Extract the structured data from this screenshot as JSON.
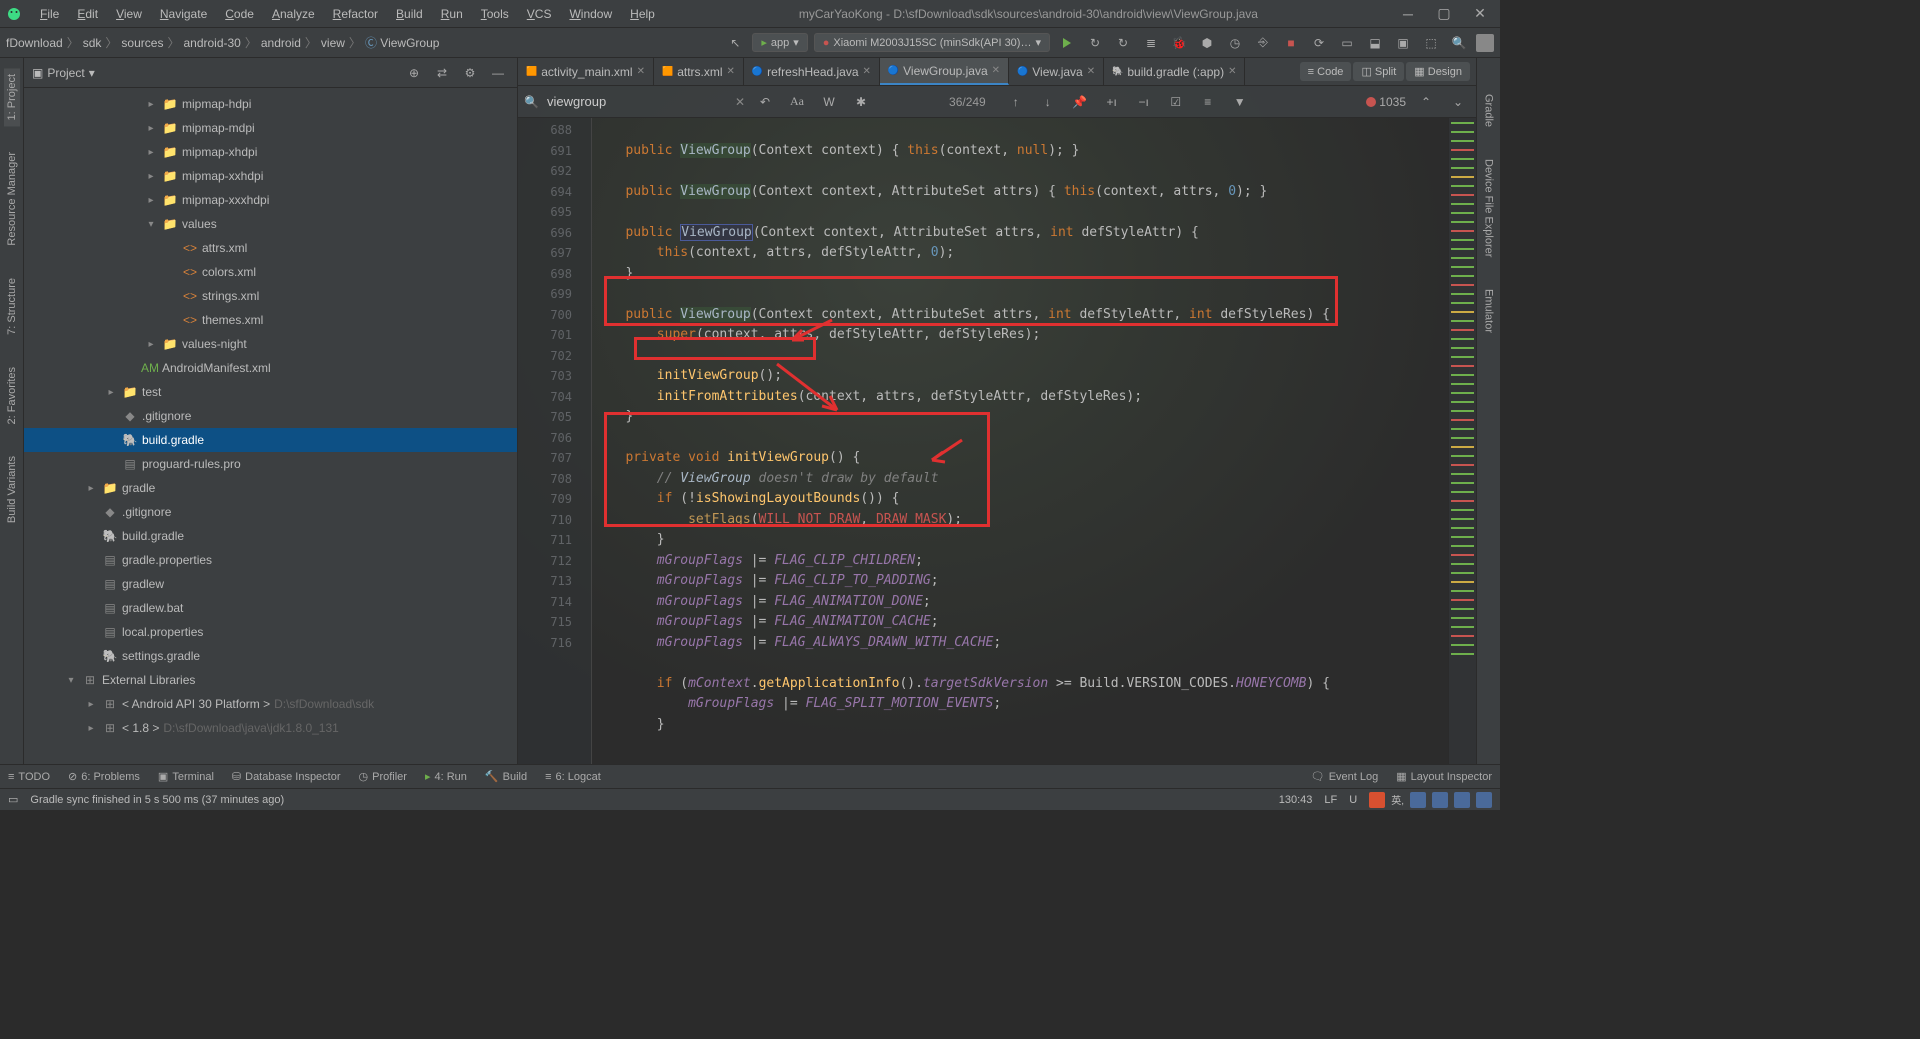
{
  "titlebar": {
    "title": "myCarYaoKong - D:\\sfDownload\\sdk\\sources\\android-30\\android\\view\\ViewGroup.java"
  },
  "menu": [
    "File",
    "Edit",
    "View",
    "Navigate",
    "Code",
    "Analyze",
    "Refactor",
    "Build",
    "Run",
    "Tools",
    "VCS",
    "Window",
    "Help"
  ],
  "breadcrumbs": [
    "fDownload",
    "sdk",
    "sources",
    "android-30",
    "android",
    "view",
    "ViewGroup"
  ],
  "run_config": {
    "app": "app",
    "device": "Xiaomi M2003J15SC (minSdk(API 30)…"
  },
  "project": {
    "title": "Project",
    "items": [
      {
        "indent": 3,
        "chev": "▸",
        "icon": "folder",
        "label": "mipmap-hdpi"
      },
      {
        "indent": 3,
        "chev": "▸",
        "icon": "folder",
        "label": "mipmap-mdpi"
      },
      {
        "indent": 3,
        "chev": "▸",
        "icon": "folder",
        "label": "mipmap-xhdpi"
      },
      {
        "indent": 3,
        "chev": "▸",
        "icon": "folder",
        "label": "mipmap-xxhdpi"
      },
      {
        "indent": 3,
        "chev": "▸",
        "icon": "folder",
        "label": "mipmap-xxxhdpi"
      },
      {
        "indent": 3,
        "chev": "▾",
        "icon": "folder",
        "label": "values"
      },
      {
        "indent": 4,
        "chev": "",
        "icon": "xml",
        "label": "attrs.xml"
      },
      {
        "indent": 4,
        "chev": "",
        "icon": "xml",
        "label": "colors.xml"
      },
      {
        "indent": 4,
        "chev": "",
        "icon": "xml",
        "label": "strings.xml"
      },
      {
        "indent": 4,
        "chev": "",
        "icon": "xml",
        "label": "themes.xml"
      },
      {
        "indent": 3,
        "chev": "▸",
        "icon": "folder",
        "label": "values-night"
      },
      {
        "indent": 2,
        "chev": "",
        "icon": "manifest",
        "label": "AndroidManifest.xml"
      },
      {
        "indent": 1,
        "chev": "▸",
        "icon": "folder",
        "label": "test"
      },
      {
        "indent": 1,
        "chev": "",
        "icon": "git",
        "label": ".gitignore"
      },
      {
        "indent": 1,
        "chev": "",
        "icon": "gradle",
        "label": "build.gradle",
        "selected": true
      },
      {
        "indent": 1,
        "chev": "",
        "icon": "file",
        "label": "proguard-rules.pro"
      },
      {
        "indent": 0,
        "chev": "▸",
        "icon": "folder",
        "label": "gradle"
      },
      {
        "indent": 0,
        "chev": "",
        "icon": "git",
        "label": ".gitignore"
      },
      {
        "indent": 0,
        "chev": "",
        "icon": "gradle",
        "label": "build.gradle"
      },
      {
        "indent": 0,
        "chev": "",
        "icon": "file",
        "label": "gradle.properties"
      },
      {
        "indent": 0,
        "chev": "",
        "icon": "file",
        "label": "gradlew"
      },
      {
        "indent": 0,
        "chev": "",
        "icon": "file",
        "label": "gradlew.bat"
      },
      {
        "indent": 0,
        "chev": "",
        "icon": "file",
        "label": "local.properties"
      },
      {
        "indent": 0,
        "chev": "",
        "icon": "gradle",
        "label": "settings.gradle"
      },
      {
        "indent": -1,
        "chev": "▾",
        "icon": "lib",
        "label": "External Libraries"
      },
      {
        "indent": 0,
        "chev": "▸",
        "icon": "lib",
        "label": "< Android API 30 Platform >",
        "muted": "D:\\sfDownload\\sdk"
      },
      {
        "indent": 0,
        "chev": "▸",
        "icon": "lib",
        "label": "< 1.8 >",
        "muted": "D:\\sfDownload\\java\\jdk1.8.0_131"
      }
    ]
  },
  "tabs": [
    {
      "icon": "xml",
      "label": "activity_main.xml"
    },
    {
      "icon": "xml",
      "label": "attrs.xml"
    },
    {
      "icon": "java",
      "label": "refreshHead.java"
    },
    {
      "icon": "java",
      "label": "ViewGroup.java",
      "active": true
    },
    {
      "icon": "java",
      "label": "View.java"
    },
    {
      "icon": "gradle",
      "label": "build.gradle (:app)"
    }
  ],
  "viewmodes": {
    "code": "Code",
    "split": "Split",
    "design": "Design"
  },
  "find": {
    "query": "viewgroup",
    "count": "36/249",
    "errors": "1035"
  },
  "gutter_lines": [
    "",
    "688",
    "691",
    "692",
    "",
    "694",
    "695",
    "696",
    "697",
    "698",
    "699",
    "700",
    "701",
    "702",
    "703",
    "704",
    "705",
    "706",
    "707",
    "708",
    "709",
    "710",
    "711",
    "712",
    "713",
    "714",
    "715",
    "716"
  ],
  "left_tabs": [
    "1: Project",
    "Resource Manager",
    "7: Structure",
    "2: Favorites",
    "Build Variants"
  ],
  "right_tabs": [
    "Gradle",
    "Device File Explorer",
    "Emulator"
  ],
  "bottom": {
    "todo": "TODO",
    "problems": "6: Problems",
    "terminal": "Terminal",
    "db": "Database Inspector",
    "profiler": "Profiler",
    "run": "4: Run",
    "build": "Build",
    "logcat": "6: Logcat",
    "eventlog": "Event Log",
    "layout": "Layout Inspector"
  },
  "status": {
    "msg": "Gradle sync finished in 5 s 500 ms (37 minutes ago)",
    "pos": "130:43",
    "lf": "LF",
    "enc": "U"
  }
}
